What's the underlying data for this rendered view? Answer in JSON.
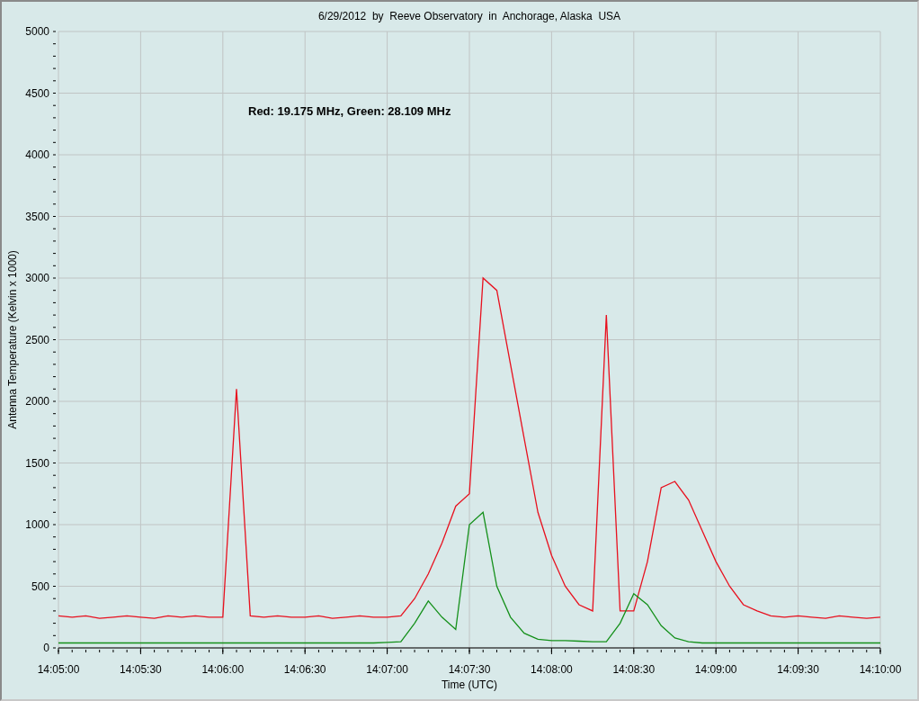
{
  "chart_data": {
    "type": "line",
    "title": "6/29/2012  by  Reeve Observatory  in  Anchorage, Alaska  USA",
    "xlabel": "Time (UTC)",
    "ylabel": "Antenna Temperature (Kelvin x 1000)",
    "categories": [
      "14:05:00",
      null,
      null,
      null,
      null,
      null,
      "14:05:30",
      null,
      null,
      null,
      null,
      null,
      "14:06:00",
      null,
      null,
      null,
      null,
      null,
      "14:06:30",
      null,
      null,
      null,
      null,
      null,
      "14:07:00",
      null,
      null,
      null,
      null,
      null,
      "14:07:30",
      null,
      null,
      null,
      null,
      null,
      "14:08:00",
      null,
      null,
      null,
      null,
      null,
      "14:08:30",
      null,
      null,
      null,
      null,
      null,
      "14:09:00",
      null,
      null,
      null,
      null,
      null,
      "14:09:30",
      null,
      null,
      null,
      null,
      null,
      "14:10:00"
    ],
    "series": [
      {
        "color": "#e8101e",
        "values": [
          260,
          250,
          260,
          240,
          250,
          260,
          250,
          240,
          260,
          250,
          260,
          250,
          250,
          2100,
          260,
          250,
          260,
          250,
          250,
          260,
          240,
          250,
          260,
          250,
          250,
          260,
          400,
          600,
          850,
          1150,
          1250,
          3000,
          2900,
          2300,
          1700,
          1100,
          750,
          500,
          350,
          300,
          2700,
          300,
          300,
          700,
          1300,
          1350,
          1200,
          950,
          700,
          500,
          350,
          300,
          260,
          250,
          260,
          250,
          240,
          260,
          250,
          240,
          250
        ]
      },
      {
        "color": "#14901a",
        "values": [
          40,
          40,
          40,
          40,
          40,
          40,
          40,
          40,
          40,
          40,
          40,
          40,
          40,
          40,
          40,
          40,
          40,
          40,
          40,
          40,
          40,
          40,
          40,
          40,
          45,
          50,
          200,
          380,
          250,
          150,
          1000,
          1100,
          500,
          250,
          120,
          70,
          60,
          60,
          55,
          50,
          50,
          200,
          440,
          350,
          180,
          80,
          50,
          40,
          40,
          40,
          40,
          40,
          40,
          40,
          40,
          40,
          40,
          40,
          40,
          40,
          40
        ]
      }
    ],
    "ylim": [
      0,
      5000
    ],
    "grid": true,
    "yticks": [
      0,
      500,
      1000,
      1500,
      2000,
      2500,
      3000,
      3500,
      4000,
      4500,
      5000
    ],
    "annotations": [
      "Red: 19.175 MHz, Green: 28.109 MHz"
    ]
  }
}
